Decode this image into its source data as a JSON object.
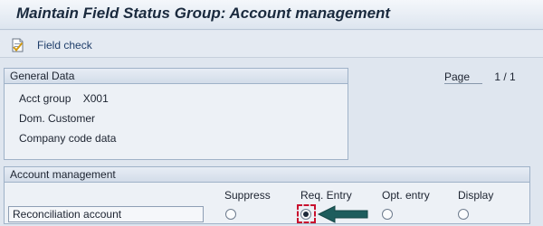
{
  "window": {
    "title": "Maintain Field Status Group: Account management"
  },
  "toolbar": {
    "field_check_label": "Field check",
    "field_check_icon": "field-check-icon"
  },
  "general_data": {
    "header": "General Data",
    "acct_group_label": "Acct group",
    "acct_group_value": "X001",
    "dom_customer": "Dom. Customer",
    "company_code_data": "Company code data"
  },
  "page": {
    "label": "Page",
    "value": "1 / 1"
  },
  "account_management": {
    "header": "Account management",
    "columns": [
      "Suppress",
      "Req. Entry",
      "Opt. entry",
      "Display"
    ],
    "field_label": "Reconciliation account",
    "selected_option": "Req. Entry"
  },
  "colors": {
    "highlight": "#c8102e",
    "arrow": "#1e5d5d"
  }
}
